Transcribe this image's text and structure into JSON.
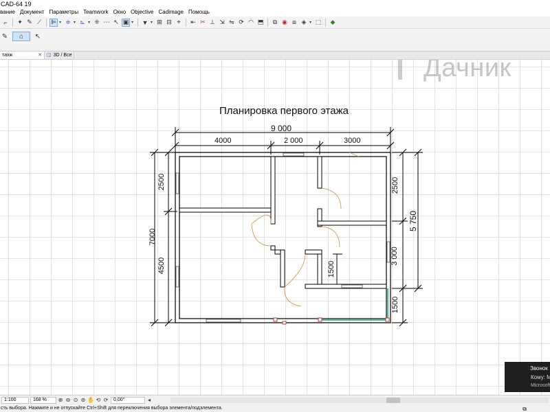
{
  "window": {
    "title": "CAD-64 19"
  },
  "menu": [
    "вание",
    "Документ",
    "Параметры",
    "Teamwork",
    "Окно",
    "Objective",
    "Cadimage",
    "Помощь"
  ],
  "tabs": [
    {
      "label": "тахж"
    },
    {
      "label": "3D / Все"
    }
  ],
  "watermark": {
    "text": "Дачник"
  },
  "plan": {
    "title": "Планировка первого этажа",
    "dims_top": {
      "overall": "9 000",
      "segments": [
        "4000",
        "2 000",
        "3000"
      ]
    },
    "dims_left": {
      "overall": "7000",
      "segments": [
        "2500",
        "4500"
      ]
    },
    "dims_right": {
      "overall": "5 750",
      "segments": [
        "2500",
        "3 000",
        "1500"
      ]
    },
    "dim_interior": "1500"
  },
  "notification": {
    "line1": "Звонок",
    "line2": "Кому: М",
    "line3": "Microsoft"
  },
  "navigator": {
    "scale": "1:100",
    "zoom": "168 %",
    "angle": "0,00°"
  },
  "status": {
    "text": "сть выбора. Нажмите и не отпускайте Ctrl+Shift для переключения выбора элемента/подэлемента."
  }
}
